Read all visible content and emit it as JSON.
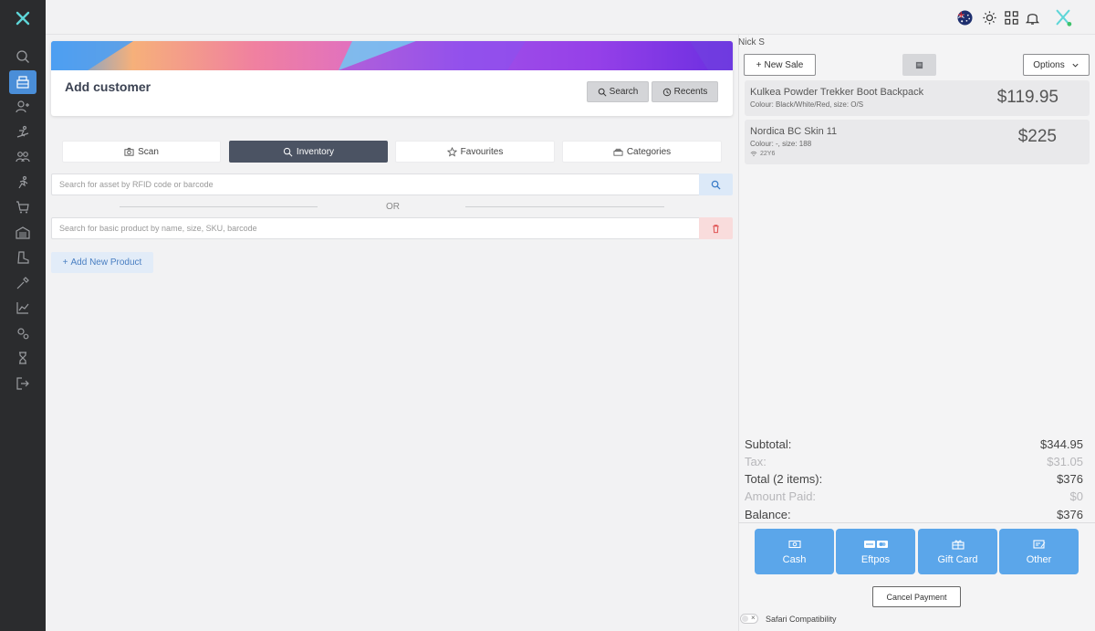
{
  "header": {
    "title": "Add customer",
    "search_label": "Search",
    "recents_label": "Recents"
  },
  "tabs": [
    {
      "label": "Scan",
      "icon": "camera-icon"
    },
    {
      "label": "Inventory",
      "icon": "search-icon"
    },
    {
      "label": "Favourites",
      "icon": "star-icon"
    },
    {
      "label": "Categories",
      "icon": "stack-icon"
    }
  ],
  "asset_search": {
    "placeholder": "Search for asset by RFID code or barcode"
  },
  "separator": "OR",
  "product_search": {
    "placeholder": "Search for basic product by name, size, SKU, barcode"
  },
  "add_product_label": "Add New Product",
  "cart": {
    "user": "Nick S",
    "new_sale_label": "New Sale",
    "options_label": "Options",
    "items": [
      {
        "name": "Kulkea Powder Trekker Boot Backpack",
        "desc": "Colour: Black/White/Red, size: O/S",
        "price": "$119.95"
      },
      {
        "name": "Nordica BC Skin 11",
        "desc": "Colour: -, size: 188",
        "tag": "22Y6",
        "price": "$225"
      }
    ],
    "totals": {
      "subtotal_label": "Subtotal:",
      "subtotal": "$344.95",
      "tax_label": "Tax:",
      "tax": "$31.05",
      "total_label": "Total (2 items):",
      "total": "$376",
      "paid_label": "Amount Paid:",
      "paid": "$0",
      "balance_label": "Balance:",
      "balance": "$376"
    }
  },
  "payments": [
    {
      "label": "Cash",
      "icon": "cash-icon"
    },
    {
      "label": "Eftpos",
      "icon": "card-icon"
    },
    {
      "label": "Gift Card",
      "icon": "gift-card-icon"
    },
    {
      "label": "Other",
      "icon": "other-payment-icon"
    }
  ],
  "cancel_label": "Cancel Payment",
  "toggle_x": "×",
  "safari_label": "Safari Compatibility",
  "colors": {
    "accent": "#5ba6ea",
    "sidebar": "#2b2c2e",
    "active_tab": "#4b5363"
  }
}
